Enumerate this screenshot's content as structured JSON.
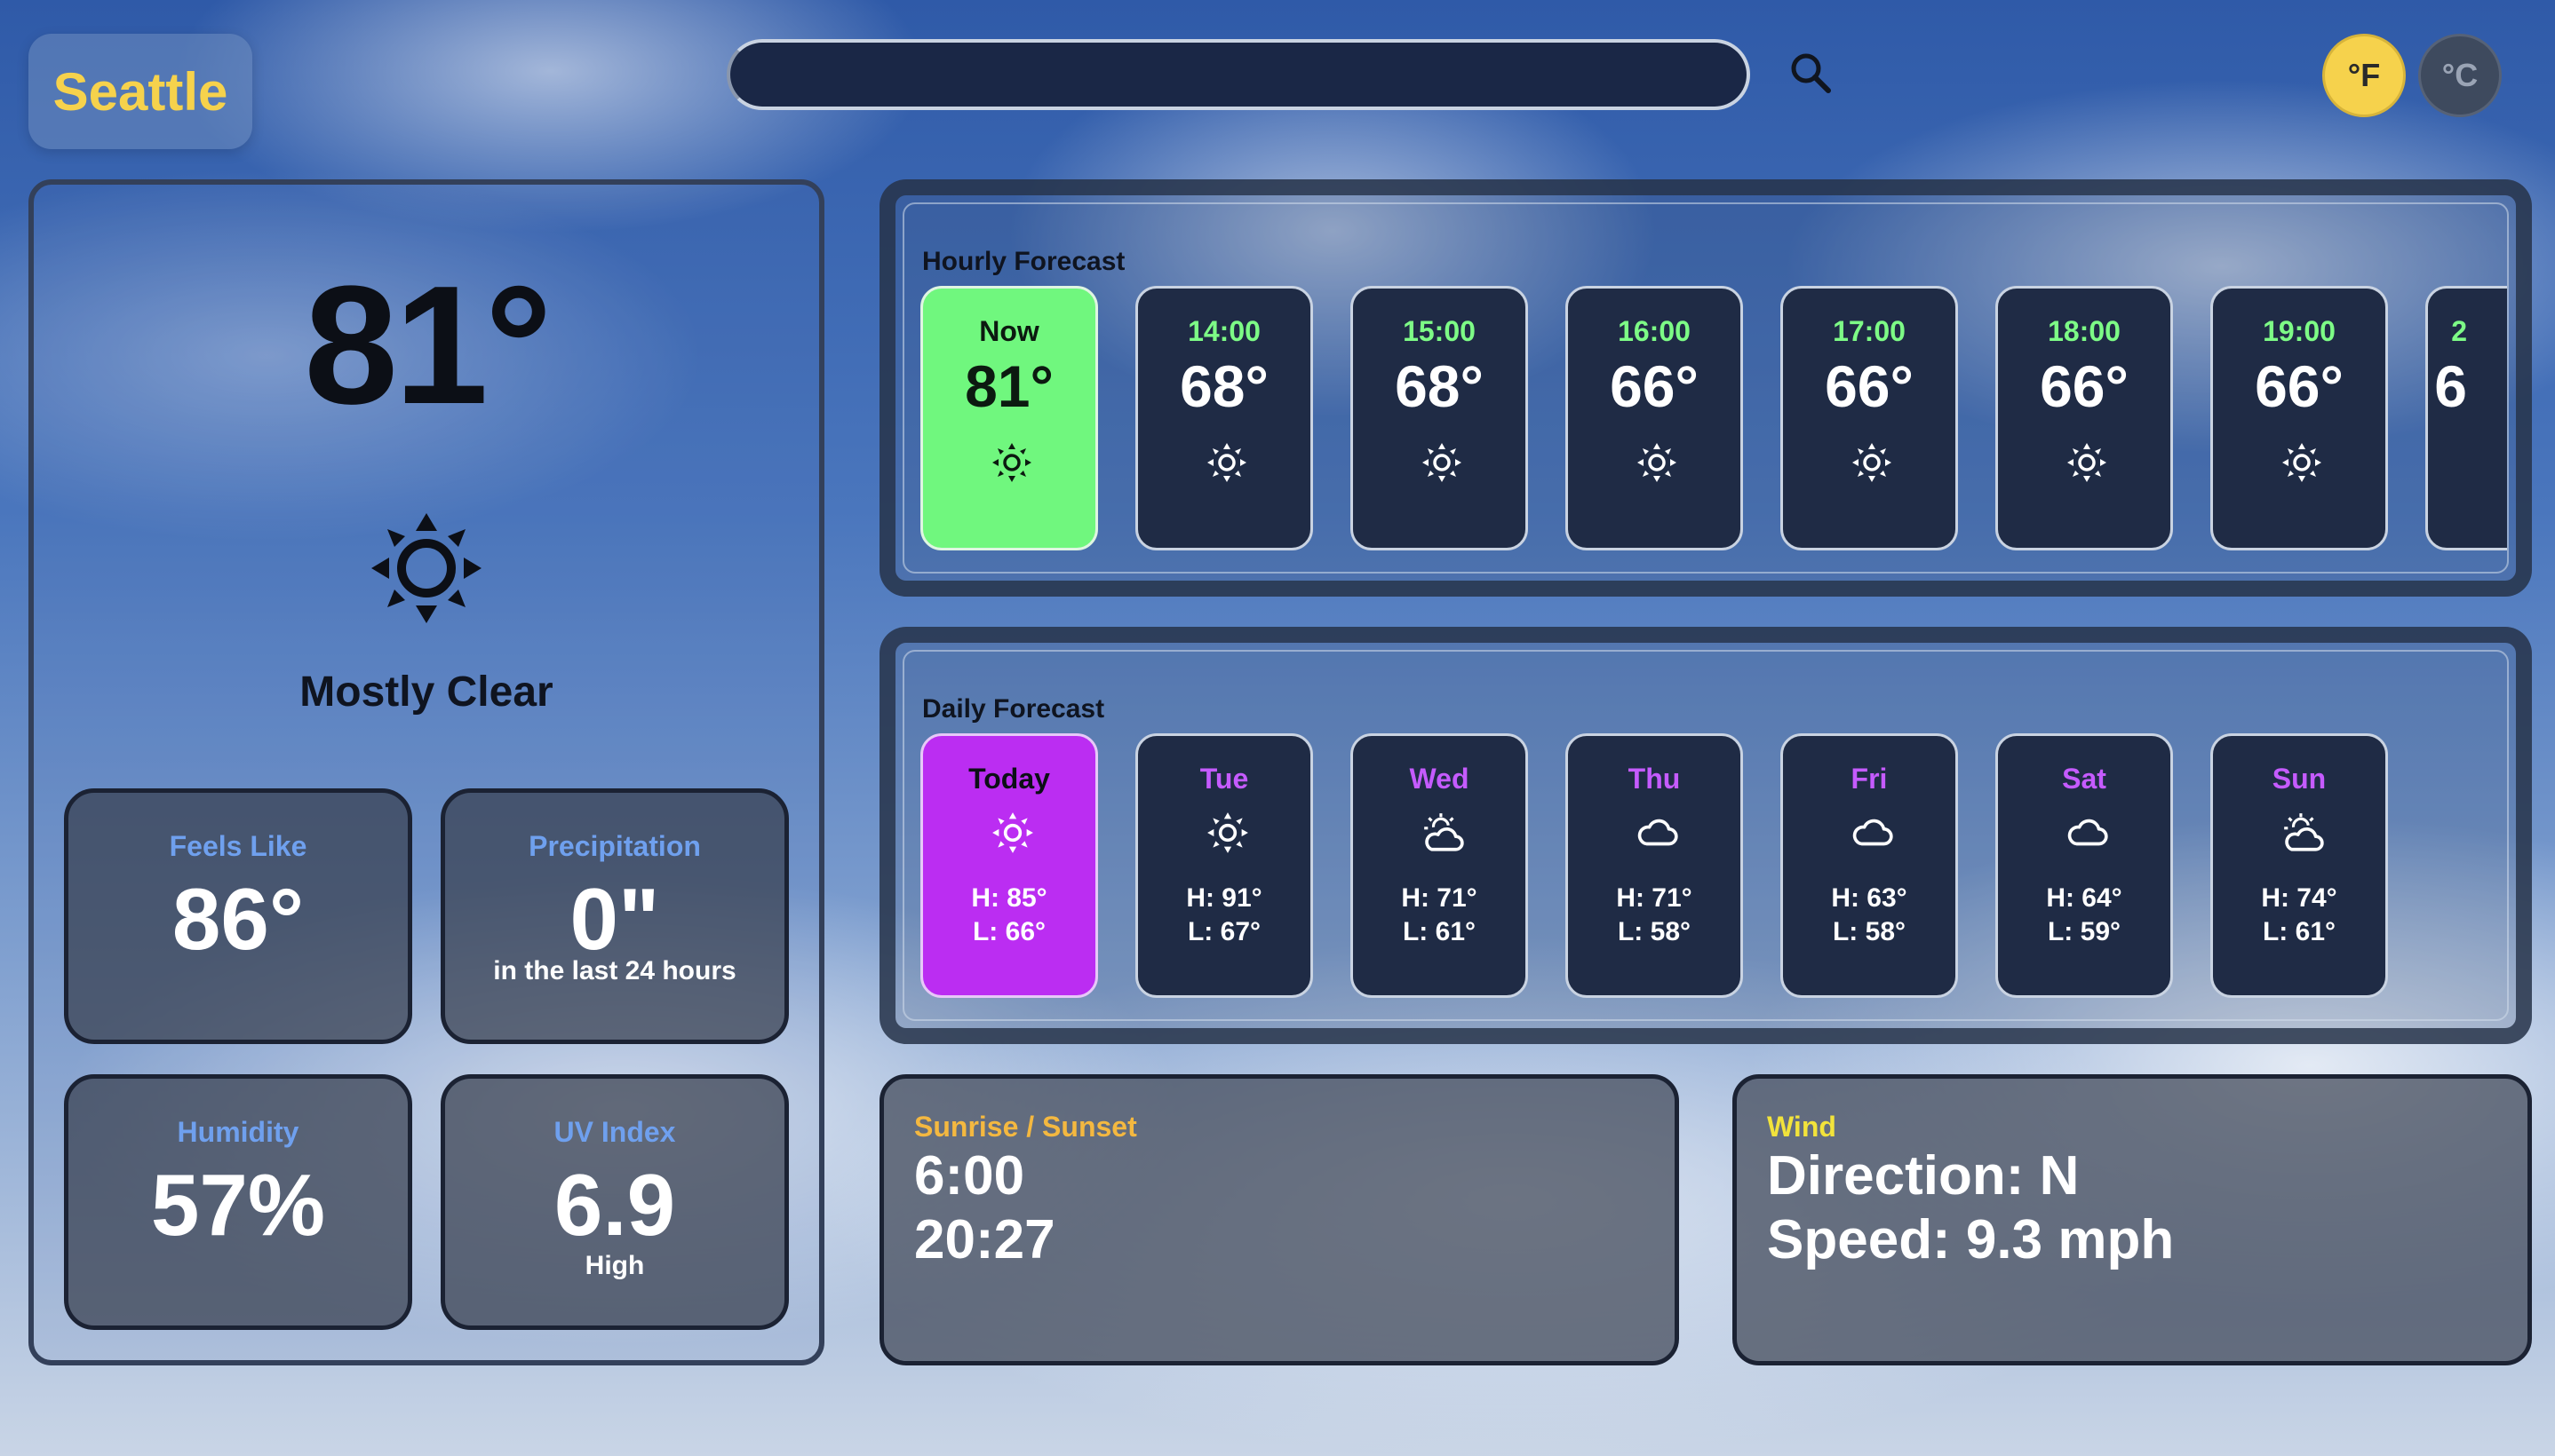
{
  "city": "Seattle",
  "search": {
    "placeholder": ""
  },
  "units": {
    "fahrenheit": "°F",
    "celsius": "°C",
    "active": "F"
  },
  "current": {
    "temp": "81°",
    "condition": "Mostly Clear",
    "icon": "sun-icon"
  },
  "stats": {
    "feels_like": {
      "label": "Feels Like",
      "value": "86°"
    },
    "precipitation": {
      "label": "Precipitation",
      "value": "0\"",
      "sub": "in the last 24 hours"
    },
    "humidity": {
      "label": "Humidity",
      "value": "57%"
    },
    "uv": {
      "label": "UV Index",
      "value": "6.9",
      "sub": "High"
    }
  },
  "hourly": {
    "title": "Hourly Forecast",
    "items": [
      {
        "label": "Now",
        "temp": "81°",
        "icon": "sun-icon"
      },
      {
        "label": "14:00",
        "temp": "68°",
        "icon": "sun-icon"
      },
      {
        "label": "15:00",
        "temp": "68°",
        "icon": "sun-icon"
      },
      {
        "label": "16:00",
        "temp": "66°",
        "icon": "sun-icon"
      },
      {
        "label": "17:00",
        "temp": "66°",
        "icon": "sun-icon"
      },
      {
        "label": "18:00",
        "temp": "66°",
        "icon": "sun-icon"
      },
      {
        "label": "19:00",
        "temp": "66°",
        "icon": "sun-icon"
      },
      {
        "label": "2",
        "temp": "6",
        "icon": ""
      }
    ]
  },
  "daily": {
    "title": "Daily Forecast",
    "items": [
      {
        "label": "Today",
        "high": "H: 85°",
        "low": "L: 66°",
        "icon": "sun-icon"
      },
      {
        "label": "Tue",
        "high": "H: 91°",
        "low": "L: 67°",
        "icon": "sun-icon"
      },
      {
        "label": "Wed",
        "high": "H: 71°",
        "low": "L: 61°",
        "icon": "partly-cloudy-icon"
      },
      {
        "label": "Thu",
        "high": "H: 71°",
        "low": "L: 58°",
        "icon": "cloud-icon"
      },
      {
        "label": "Fri",
        "high": "H: 63°",
        "low": "L: 58°",
        "icon": "cloud-icon"
      },
      {
        "label": "Sat",
        "high": "H: 64°",
        "low": "L: 59°",
        "icon": "cloud-icon"
      },
      {
        "label": "Sun",
        "high": "H: 74°",
        "low": "L: 61°",
        "icon": "partly-cloudy-icon"
      }
    ]
  },
  "sun": {
    "label": "Sunrise / Sunset",
    "sunrise": "6:00",
    "sunset": "20:27"
  },
  "wind": {
    "label": "Wind",
    "direction": "Direction: N",
    "speed": "Speed: 9.3 mph"
  },
  "colors": {
    "accent_yellow": "#f6d24c",
    "hourly_label": "#7dfb86",
    "now_card": "#70f77e",
    "daily_label": "#c55bff",
    "today_card": "#bb2df2",
    "stat_label": "#6fa0ee",
    "sun_label": "#f4b840",
    "wind_label": "#f2e33b"
  }
}
